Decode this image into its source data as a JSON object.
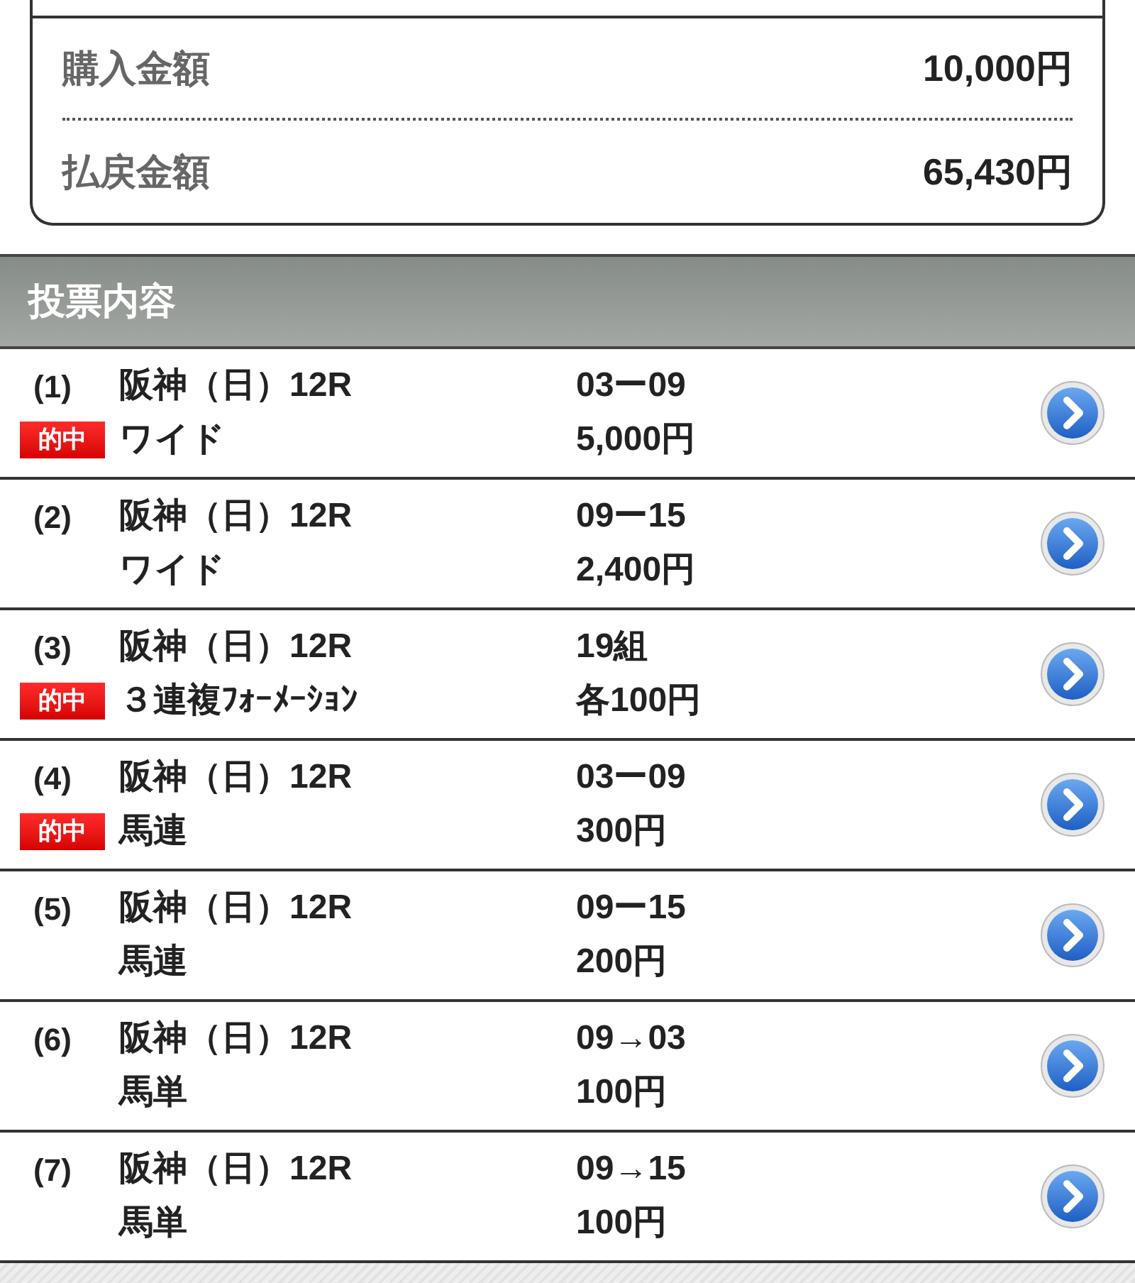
{
  "summary": [
    {
      "label": "購入金額",
      "value": "10,000円"
    },
    {
      "label": "払戻金額",
      "value": "65,430円"
    }
  ],
  "section": {
    "title": "投票内容"
  },
  "bets": [
    {
      "number": "(1)",
      "race": "阪神（日）12R",
      "type": "ワイド",
      "combination": "03ー09",
      "amount": "5,000円",
      "hit": true,
      "hit_label": "的中"
    },
    {
      "number": "(2)",
      "race": "阪神（日）12R",
      "type": "ワイド",
      "combination": "09ー15",
      "amount": "2,400円",
      "hit": false
    },
    {
      "number": "(3)",
      "race": "阪神（日）12R",
      "type": "３連複ﾌｫｰﾒｰｼｮﾝ",
      "combination": "19組",
      "amount": "各100円",
      "hit": true,
      "hit_label": "的中"
    },
    {
      "number": "(4)",
      "race": "阪神（日）12R",
      "type": "馬連",
      "combination": "03ー09",
      "amount": "300円",
      "hit": true,
      "hit_label": "的中"
    },
    {
      "number": "(5)",
      "race": "阪神（日）12R",
      "type": "馬連",
      "combination": "09ー15",
      "amount": "200円",
      "hit": false
    },
    {
      "number": "(6)",
      "race": "阪神（日）12R",
      "type": "馬単",
      "combination": "09→03",
      "amount": "100円",
      "hit": false
    },
    {
      "number": "(7)",
      "race": "阪神（日）12R",
      "type": "馬単",
      "combination": "09→15",
      "amount": "100円",
      "hit": false
    }
  ]
}
